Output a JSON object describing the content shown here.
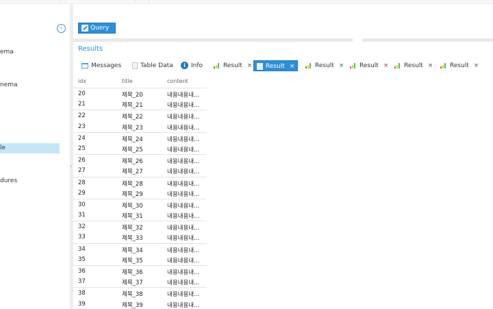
{
  "sidebar": {
    "collapse_icon": "circle-left-arrow-icon",
    "items": [
      {
        "label": "ema",
        "selected": false
      },
      {
        "label": "nema",
        "selected": false
      },
      {
        "label": "le",
        "selected": true
      },
      {
        "label": "dures",
        "selected": false
      }
    ]
  },
  "toolbar": {
    "query_label": "Query"
  },
  "results": {
    "title": "Results",
    "tabs": [
      {
        "label": "Messages",
        "icon": "messages-icon",
        "active": false,
        "closable": false
      },
      {
        "label": "Table Data",
        "icon": "table-icon",
        "active": false,
        "closable": false
      },
      {
        "label": "Info",
        "icon": "info-icon",
        "active": false,
        "closable": false
      },
      {
        "label": "Result",
        "icon": "bar-chart-icon",
        "active": false,
        "closable": true
      },
      {
        "label": "Result",
        "icon": "document-icon",
        "active": true,
        "closable": true
      },
      {
        "label": "Result",
        "icon": "bar-chart-icon",
        "active": false,
        "closable": true
      },
      {
        "label": "Result",
        "icon": "bar-chart-icon",
        "active": false,
        "closable": true
      },
      {
        "label": "Result",
        "icon": "bar-chart-icon",
        "active": false,
        "closable": true
      },
      {
        "label": "Result",
        "icon": "bar-chart-icon",
        "active": false,
        "closable": true
      }
    ],
    "close_glyph": "×",
    "columns": [
      "idx",
      "title",
      "content"
    ],
    "rows": [
      {
        "idx": "20",
        "title": "제목_20",
        "content": "내용내용내..."
      },
      {
        "idx": "21",
        "title": "제목_21",
        "content": "내용내용내..."
      },
      {
        "idx": "22",
        "title": "제목_22",
        "content": "내용내용내..."
      },
      {
        "idx": "23",
        "title": "제목_23",
        "content": "내용내용내..."
      },
      {
        "idx": "24",
        "title": "제목_24",
        "content": "내용내용내..."
      },
      {
        "idx": "25",
        "title": "제목_25",
        "content": "내용내용내..."
      },
      {
        "idx": "26",
        "title": "제목_26",
        "content": "내용내용내..."
      },
      {
        "idx": "27",
        "title": "제목_27",
        "content": "내용내용내..."
      },
      {
        "idx": "28",
        "title": "제목_28",
        "content": "내용내용내..."
      },
      {
        "idx": "29",
        "title": "제목_29",
        "content": "내용내용내..."
      },
      {
        "idx": "30",
        "title": "제목_30",
        "content": "내용내용내..."
      },
      {
        "idx": "31",
        "title": "제목_31",
        "content": "내용내용내..."
      },
      {
        "idx": "32",
        "title": "제목_32",
        "content": "내용내용내..."
      },
      {
        "idx": "33",
        "title": "제목_33",
        "content": "내용내용내..."
      },
      {
        "idx": "34",
        "title": "제목_34",
        "content": "내용내용내..."
      },
      {
        "idx": "35",
        "title": "제목_35",
        "content": "내용내용내..."
      },
      {
        "idx": "36",
        "title": "제목_36",
        "content": "내용내용내..."
      },
      {
        "idx": "37",
        "title": "제목_37",
        "content": "내용내용내..."
      },
      {
        "idx": "38",
        "title": "제목_38",
        "content": "내용내용내..."
      },
      {
        "idx": "39",
        "title": "제목_39",
        "content": "내용내용내..."
      }
    ]
  },
  "colors": {
    "accent": "#2f8fd6",
    "selected_row": "#c6e6f8",
    "splitter": "#e9e9e9"
  }
}
